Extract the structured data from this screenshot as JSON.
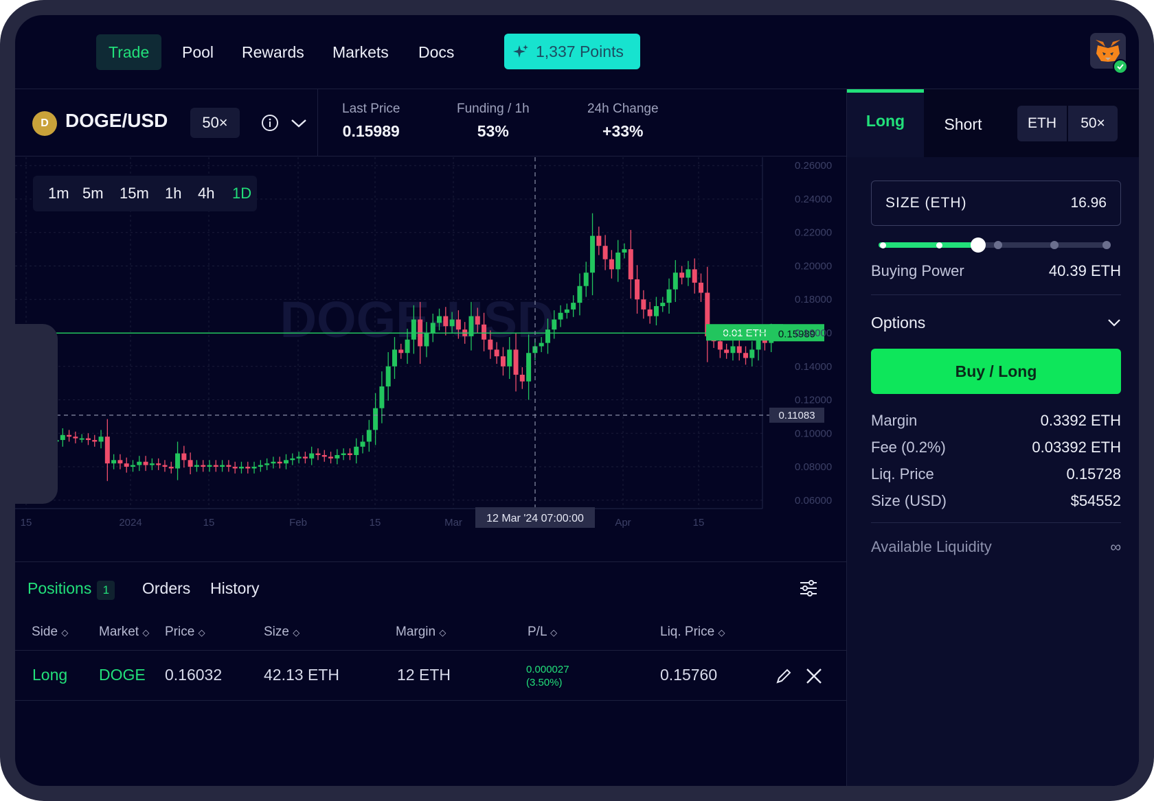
{
  "nav": {
    "items": [
      "Trade",
      "Pool",
      "Rewards",
      "Markets",
      "Docs"
    ],
    "active": "Trade",
    "points_label": "1,337 Points"
  },
  "market": {
    "pair": "DOGE/USD",
    "coin_letter": "D",
    "leverage": "50×",
    "stats": [
      {
        "label": "Last Price",
        "value": "0.15989"
      },
      {
        "label": "Funding / 1h",
        "value": "53%"
      },
      {
        "label": "24h Change",
        "value": "+33%"
      }
    ]
  },
  "chart": {
    "timeframes": [
      "1m",
      "5m",
      "15m",
      "1h",
      "4h",
      "1D"
    ],
    "active_timeframe": "1D",
    "watermark": "DOGE-USD",
    "crosshair_label": "12 Mar '24   07:00:00",
    "order_tag": "0.01 ETH",
    "colors": {
      "up": "#22c55e",
      "down": "#ef4d6b",
      "bg": "#040523"
    }
  },
  "chart_data": {
    "type": "candlestick",
    "title": "DOGE-USD",
    "xlabel": "",
    "ylabel": "",
    "x_ticks": [
      "15",
      "2024",
      "15",
      "Feb",
      "15",
      "Mar",
      "Apr",
      "15"
    ],
    "y_ticks": [
      "0.26000",
      "0.24000",
      "0.22000",
      "0.20000",
      "0.18000",
      "0.16000",
      "0.14000",
      "0.12000",
      "0.10000",
      "0.08000",
      "0.06000"
    ],
    "ylim": [
      0.055,
      0.265
    ],
    "grid": true,
    "price_lines": [
      {
        "label": "0.16032",
        "value": 0.16032,
        "style": "order",
        "color": "#22c55e"
      },
      {
        "label": "0.15989",
        "value": 0.15989,
        "style": "last",
        "color": "#22c55e"
      },
      {
        "label": "0.11083",
        "value": 0.11083,
        "style": "crosshair",
        "color": "#9aa0b5"
      }
    ],
    "close_series": [
      0.096,
      0.099,
      0.098,
      0.097,
      0.097,
      0.096,
      0.095,
      0.098,
      0.082,
      0.084,
      0.082,
      0.08,
      0.081,
      0.083,
      0.081,
      0.082,
      0.081,
      0.08,
      0.079,
      0.088,
      0.084,
      0.08,
      0.081,
      0.08,
      0.081,
      0.08,
      0.081,
      0.08,
      0.079,
      0.08,
      0.079,
      0.08,
      0.081,
      0.082,
      0.083,
      0.082,
      0.084,
      0.085,
      0.086,
      0.085,
      0.088,
      0.087,
      0.086,
      0.085,
      0.087,
      0.088,
      0.087,
      0.092,
      0.095,
      0.102,
      0.115,
      0.128,
      0.14,
      0.15,
      0.148,
      0.156,
      0.168,
      0.152,
      0.16,
      0.166,
      0.17,
      0.164,
      0.168,
      0.162,
      0.158,
      0.17,
      0.165,
      0.156,
      0.15,
      0.146,
      0.14,
      0.15,
      0.135,
      0.131,
      0.148,
      0.152,
      0.154,
      0.162,
      0.168,
      0.172,
      0.174,
      0.178,
      0.188,
      0.196,
      0.218,
      0.212,
      0.204,
      0.198,
      0.208,
      0.21,
      0.192,
      0.18,
      0.174,
      0.17,
      0.176,
      0.178,
      0.186,
      0.196,
      0.193,
      0.198,
      0.19,
      0.184,
      0.158,
      0.155,
      0.15,
      0.148,
      0.152,
      0.148,
      0.145,
      0.15,
      0.158,
      0.154,
      0.16
    ]
  },
  "positions": {
    "tabs": [
      "Positions",
      "Orders",
      "History"
    ],
    "count": "1",
    "columns": [
      "Side",
      "Market",
      "Price",
      "Size",
      "Margin",
      "P/L",
      "Liq. Price"
    ],
    "rows": [
      {
        "side": "Long",
        "market": "DOGE",
        "price": "0.16032",
        "size": "42.13 ETH",
        "margin": "12 ETH",
        "pl": "0.000027",
        "pl_pct": "(3.50%)",
        "liq": "0.15760"
      }
    ]
  },
  "order": {
    "tab_long": "Long",
    "tab_short": "Short",
    "asset": "ETH",
    "leverage": "50×",
    "size_label": "SIZE (ETH)",
    "size_value": "16.96",
    "slider_fraction": 0.43,
    "buying_power_label": "Buying Power",
    "buying_power_value": "40.39 ETH",
    "options_label": "Options",
    "buy_label": "Buy / Long",
    "details": [
      {
        "k": "Margin",
        "v": "0.3392 ETH"
      },
      {
        "k": "Fee (0.2%)",
        "v": "0.03392 ETH"
      },
      {
        "k": "Liq. Price",
        "v": "0.15728"
      },
      {
        "k": "Size (USD)",
        "v": "$54552"
      }
    ],
    "liquidity_label": "Available Liquidity",
    "liquidity_value": "∞"
  }
}
